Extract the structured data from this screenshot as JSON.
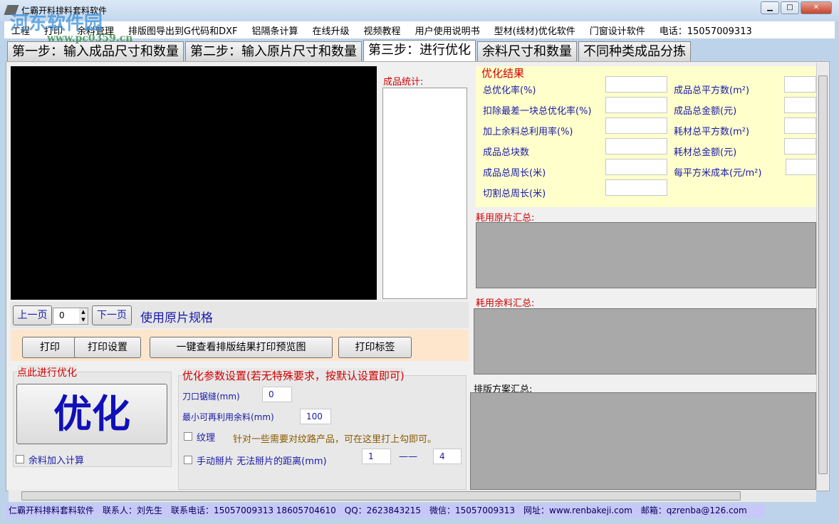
{
  "window": {
    "title": "仁霸开料排料套料软件",
    "minimize": "▁",
    "maximize": "□",
    "close": "✕"
  },
  "watermark": {
    "name": "河东软件园",
    "url": "www.pc0359.cn"
  },
  "menu": [
    "工程",
    "打印",
    "余料管理",
    "排版图导出到G代码和DXF",
    "铝隔条计算",
    "在线升级",
    "视频教程",
    "用户使用说明书",
    "型材(线材)优化软件",
    "门窗设计软件",
    "电话：15057009313"
  ],
  "tabs": [
    {
      "label": "第一步：输入成品尺寸和数量"
    },
    {
      "label": "第二步：输入原片尺寸和数量"
    },
    {
      "label": "第三步：进行优化",
      "active": true
    },
    {
      "label": "余料尺寸和数量"
    },
    {
      "label": "不同种类成品分拣"
    }
  ],
  "stats_label": "成品统计:",
  "pager": {
    "prev": "上一页",
    "page": "0",
    "next": "下一页",
    "use_sheet": "使用原片规格"
  },
  "print": {
    "print": "打印",
    "settings": "打印设置",
    "preview": "一键查看排版结果打印预览图",
    "label": "打印标签"
  },
  "optimize": {
    "group": "点此进行优化",
    "button": "优化",
    "leftover_check": "余料加入计算"
  },
  "params": {
    "group": "优化参数设置(若无特殊要求，按默认设置即可)",
    "kerf_label": "刀口锯缝(mm)",
    "kerf": "0",
    "min_leftover_label": "最小可再利用余料(mm)",
    "min_leftover": "100",
    "grain_label": "纹理",
    "grain_hint": "针对一些需要对纹路产品，可在这里打上勾即可。",
    "manual_label": "手动掰片 无法掰片的距离(mm)",
    "manual_from": "1",
    "dash": "——",
    "manual_to": "4"
  },
  "results": {
    "title": "优化结果",
    "left": [
      "总优化率(%)",
      "扣除最差一块总优化率(%)",
      "加上余料总利用率(%)",
      "成品总块数",
      "成品总周长(米)",
      "切割总周长(米)"
    ],
    "right": [
      "成品总平方数(m²)",
      "成品总金额(元)",
      "耗材总平方数(m²)",
      "耗材总金额(元)",
      "每平方米成本(元/m²)"
    ]
  },
  "summaries": {
    "sheets": "耗用原片汇总:",
    "leftover": "耗用余料汇总:",
    "plan": "排版方案汇总:"
  },
  "statusbar": "仁霸开料排料套料软件　联系人：刘先生　联系电话：15057009313 18605704610　QQ：2623843215　微信：15057009313　网址：www.renbakeji.com　邮箱：qzrenba@126.com"
}
